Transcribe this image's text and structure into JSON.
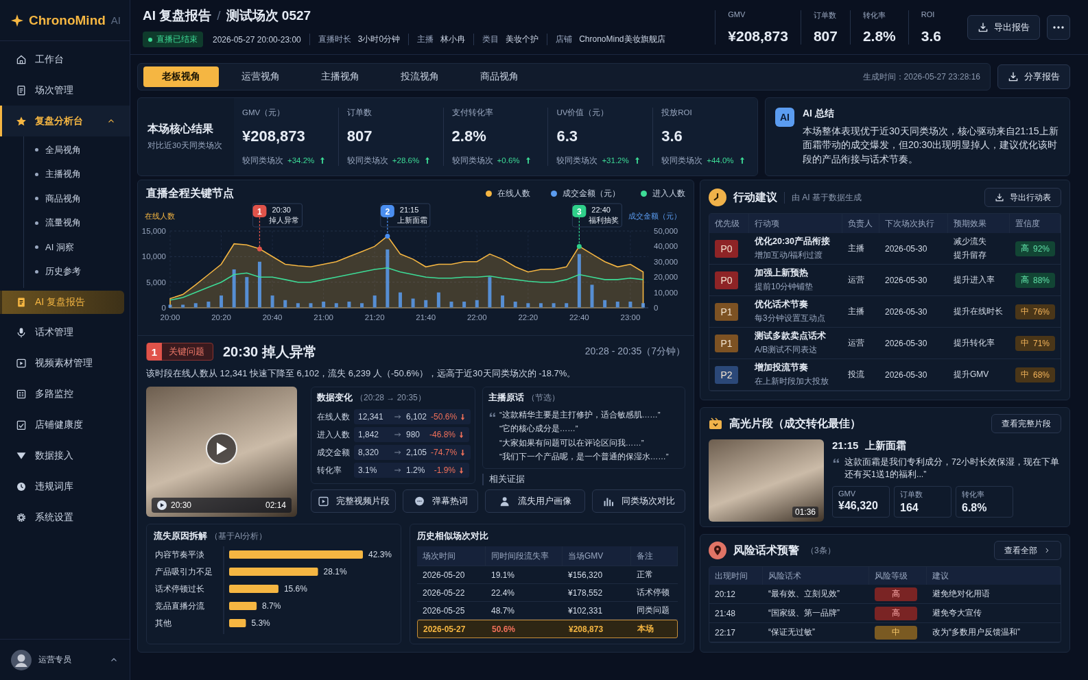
{
  "sidebar": {
    "logo": "ChronoMind",
    "logo_suffix": "AI",
    "items": [
      {
        "label": "工作台",
        "selected": false
      },
      {
        "label": "场次管理",
        "selected": false
      },
      {
        "label": "复盘分析台",
        "selected": false,
        "expanded": true,
        "children": [
          {
            "label": "全局视角",
            "selected": false
          },
          {
            "label": "主播视角",
            "selected": false
          },
          {
            "label": "商品视角",
            "selected": false
          },
          {
            "label": "流量视角",
            "selected": false
          },
          {
            "label": "AI 洞察",
            "selected": false
          },
          {
            "label": "历史参考",
            "selected": false
          }
        ]
      },
      {
        "label": "AI 复盘报告",
        "selected": true
      },
      {
        "label": "话术管理",
        "selected": false
      },
      {
        "label": "视频素材管理",
        "selected": false
      },
      {
        "label": "多路监控",
        "selected": false
      },
      {
        "label": "店铺健康度",
        "selected": false
      },
      {
        "label": "数据接入",
        "selected": false
      },
      {
        "label": "违规词库",
        "selected": false
      },
      {
        "label": "系统设置",
        "selected": false
      }
    ],
    "user": {
      "name": "运营专员"
    }
  },
  "header": {
    "title": "AI 复盘报告",
    "separator": "/",
    "subtitle": "测试场次 0527",
    "status": "直播已结束",
    "meta": [
      {
        "value": "2026-05-27 20:00-23:00"
      },
      {
        "label": "直播时长",
        "value": "3小时0分钟"
      },
      {
        "label": "主播",
        "value": "林小冉"
      },
      {
        "label": "类目",
        "value": "美妆个护"
      },
      {
        "label": "店铺",
        "value": "ChronoMind美妆旗舰店"
      }
    ],
    "stats": [
      {
        "label": "GMV",
        "value": "¥208,873"
      },
      {
        "label": "订单数",
        "value": "807"
      },
      {
        "label": "转化率",
        "value": "2.8%"
      },
      {
        "label": "ROI",
        "value": "3.6"
      }
    ],
    "export_button": "导出报告"
  },
  "tabs": [
    {
      "label": "老板视角",
      "selected": true
    },
    {
      "label": "运营视角",
      "selected": false
    },
    {
      "label": "主播视角",
      "selected": false
    },
    {
      "label": "投流视角",
      "selected": false
    },
    {
      "label": "商品视角",
      "selected": false
    }
  ],
  "generated_at": "生成时间：2026-05-27 23:28:16",
  "share_button": "分享报告",
  "core_results": {
    "title": "本场核心结果",
    "subtitle": "对比近30天同类场次",
    "metrics": [
      {
        "label": "GMV（元）",
        "value": "¥208,873",
        "compare_label": "较同类场次",
        "change": "+34.2%",
        "kind": "up"
      },
      {
        "label": "订单数",
        "value": "807",
        "compare_label": "较同类场次",
        "change": "+28.6%",
        "kind": "up"
      },
      {
        "label": "支付转化率",
        "value": "2.8%",
        "compare_label": "较同类场次",
        "change": "+0.6%",
        "kind": "up"
      },
      {
        "label": "UV价值（元）",
        "value": "6.3",
        "compare_label": "较同类场次",
        "change": "+31.2%",
        "kind": "up"
      },
      {
        "label": "投放ROI",
        "value": "3.6",
        "compare_label": "较同类场次",
        "change": "+44.0%",
        "kind": "up"
      }
    ]
  },
  "ai_summary": {
    "badge": "AI",
    "title": "AI 总结",
    "text": "本场整体表现优于近30天同类场次，核心驱动来自21:15上新面霜带动的成交爆发，但20:30出现明显掉人，建议优化该时段的产品衔接与话术节奏。"
  },
  "key_nodes": {
    "title": "直播全程关键节点",
    "markers": [
      {
        "number": "1",
        "time": "20:30",
        "color": "#e0534a"
      },
      {
        "number": "2",
        "time": "21:15",
        "color": "#4a8ef0"
      },
      {
        "number": "3",
        "time": "22:40",
        "color": "#2fcf8a"
      }
    ],
    "chart_data": {
      "type": "line",
      "ylabel": "在线人数",
      "y2label": "成交金额（元）",
      "categories": [
        "20:00",
        null,
        null,
        null,
        "20:20",
        null,
        null,
        null,
        "20:40",
        null,
        null,
        null,
        "21:00",
        null,
        null,
        null,
        "21:20",
        null,
        null,
        null,
        "21:40",
        null,
        null,
        null,
        "22:00",
        null,
        null,
        null,
        "22:20",
        null,
        null,
        null,
        "22:40",
        null,
        null,
        null,
        "23:00",
        null
      ],
      "ylim": [
        0,
        15000
      ],
      "y2lim": [
        0,
        50000
      ],
      "grid": true,
      "yticks": [
        {
          "value": 0,
          "label": "0"
        },
        {
          "value": 5000,
          "label": "5,000"
        },
        {
          "value": 10000,
          "label": "10,000"
        },
        {
          "value": 15000,
          "label": "15,000"
        }
      ],
      "y2ticks": [
        {
          "value": 0,
          "label": "0"
        },
        {
          "value": 10000,
          "label": "10,000"
        },
        {
          "value": 20000,
          "label": "20,000"
        },
        {
          "value": 30000,
          "label": "30,000"
        },
        {
          "value": 40000,
          "label": "40,000"
        },
        {
          "value": 50000,
          "label": "50,000"
        }
      ],
      "series": [
        {
          "name": "在线人数",
          "color": "#f5b642",
          "type": "area",
          "values": [
            1800,
            2600,
            4500,
            6500,
            8500,
            12500,
            12300,
            11500,
            10000,
            8500,
            8200,
            8000,
            8500,
            9000,
            10000,
            11000,
            12000,
            14000,
            10500,
            9500,
            8000,
            8500,
            8500,
            9000,
            9000,
            10500,
            9500,
            8000,
            7000,
            7500,
            7500,
            8000,
            12000,
            10500,
            9000,
            8000,
            8500,
            7000
          ]
        },
        {
          "name": "成交金额（元）",
          "color": "#5b9cf0",
          "type": "bar",
          "axis": "y2",
          "values": [
            2000,
            2000,
            3000,
            4000,
            8000,
            25000,
            20000,
            30000,
            8000,
            5000,
            3000,
            3000,
            4000,
            3000,
            4000,
            3000,
            8000,
            38000,
            10000,
            6000,
            5000,
            10000,
            4000,
            4000,
            5000,
            20000,
            8000,
            4000,
            3000,
            3000,
            3000,
            3000,
            35000,
            15000,
            5000,
            4000,
            4000,
            3000
          ]
        },
        {
          "name": "进入人数",
          "color": "#3ddc97",
          "type": "line",
          "values": [
            1500,
            2000,
            3000,
            4000,
            5000,
            6500,
            6800,
            6000,
            6000,
            5500,
            5000,
            5000,
            5500,
            6000,
            6500,
            7000,
            7500,
            7800,
            7000,
            6500,
            6000,
            5800,
            5800,
            6000,
            6000,
            6200,
            5800,
            5500,
            5200,
            5000,
            5000,
            5500,
            6500,
            6000,
            5500,
            5500,
            5800,
            5500
          ]
        }
      ],
      "annotations": [
        "掉人异常",
        "上新面霜",
        "福利抽奖"
      ]
    }
  },
  "key_issue": {
    "number": "1",
    "tag": "关键问题",
    "title": "20:30 掉人异常",
    "range": "20:28 - 20:35（7分钟）",
    "description": "该时段在线人数从 12,341 快速下降至 6,102，流失 6,239 人（-50.6%），远高于近30天同类场次的 -18.7%。",
    "video": {
      "start": "20:30",
      "duration": "02:14"
    },
    "data_change": {
      "title": "数据变化",
      "range": "（20:28 → 20:35）",
      "rows": [
        {
          "label": "在线人数",
          "from": "12,341",
          "to": "6,102",
          "change": "-50.6%",
          "kind": "down"
        },
        {
          "label": "进入人数",
          "from": "1,842",
          "to": "980",
          "change": "-46.8%",
          "kind": "down"
        },
        {
          "label": "成交金额",
          "from": "8,320",
          "to": "2,105",
          "change": "-74.7%",
          "kind": "down"
        },
        {
          "label": "转化率",
          "from": "3.1%",
          "to": "1.2%",
          "change": "-1.9%",
          "kind": "down"
        }
      ]
    },
    "quotes": {
      "title": "主播原话",
      "note": "（节选）",
      "lines": [
        "“这款精华主要是主打修护，适合敏感肌……”",
        "“它的核心成分是……”",
        "“大家如果有问题可以在评论区问我……”",
        "“我们下一个产品呢，是一个普通的保湿水……”"
      ]
    },
    "evidence": {
      "title": "相关证据",
      "buttons": [
        "完整视频片段",
        "弹幕热词",
        "流失用户画像",
        "同类场次对比"
      ]
    },
    "loss_reasons": {
      "title": "流失原因拆解",
      "note": "（基于AI分析）",
      "chart_data": {
        "type": "bar",
        "orientation": "horizontal",
        "categories": [
          "内容节奏平淡",
          "产品吸引力不足",
          "话术停顿过长",
          "竞品直播分流",
          "其他"
        ],
        "values": [
          42.3,
          28.1,
          15.6,
          8.7,
          5.3
        ],
        "value_labels": [
          "42.3%",
          "28.1%",
          "15.6%",
          "8.7%",
          "5.3%"
        ]
      }
    },
    "history": {
      "title": "历史相似场次对比",
      "columns": [
        "场次时间",
        "同时间段流失率",
        "当场GMV",
        "备注"
      ],
      "rows": [
        {
          "cells": [
            "2026-05-20",
            "19.1%",
            "¥156,320",
            "正常"
          ],
          "highlighted": false
        },
        {
          "cells": [
            "2026-05-22",
            "22.4%",
            "¥178,552",
            "话术停顿"
          ],
          "highlighted": false
        },
        {
          "cells": [
            "2026-05-25",
            "48.7%",
            "¥102,331",
            "同类问题"
          ],
          "highlighted": false
        },
        {
          "cells": [
            "2026-05-27",
            "50.6%",
            "¥208,873",
            "本场"
          ],
          "highlighted": true
        }
      ]
    }
  },
  "actions": {
    "title": "行动建议",
    "subtitle": "由 AI 基于数据生成",
    "export_button": "导出行动表",
    "columns": [
      "优先级",
      "行动项",
      "负责人",
      "下次场次执行",
      "预期效果",
      "置信度"
    ],
    "rows": [
      {
        "priority": "P0",
        "color": "#8e2426",
        "title": "优化20:30产品衔接",
        "detail": "增加互动/福利过渡",
        "owner": "主播",
        "date": "2026-05-30",
        "effect": [
          "减少流失",
          "提升留存"
        ],
        "kind": "high",
        "confidence_label": "高",
        "confidence": "92%"
      },
      {
        "priority": "P0",
        "color": "#8e2426",
        "title": "加强上新预热",
        "detail": "提前10分钟铺垫",
        "owner": "运营",
        "date": "2026-05-30",
        "effect": [
          "提升进入率"
        ],
        "kind": "high",
        "confidence_label": "高",
        "confidence": "88%"
      },
      {
        "priority": "P1",
        "color": "#7d5223",
        "title": "优化话术节奏",
        "detail": "每3分钟设置互动点",
        "owner": "主播",
        "date": "2026-05-30",
        "effect": [
          "提升在线时长"
        ],
        "kind": "medium",
        "confidence_label": "中",
        "confidence": "76%"
      },
      {
        "priority": "P1",
        "color": "#7d5223",
        "title": "测试多款卖点话术",
        "detail": "A/B测试不同表达",
        "owner": "运营",
        "date": "2026-05-30",
        "effect": [
          "提升转化率"
        ],
        "kind": "medium",
        "confidence_label": "中",
        "confidence": "71%"
      },
      {
        "priority": "P2",
        "color": "#2b4878",
        "title": "增加投流节奏",
        "detail": "在上新时段加大投放",
        "owner": "投流",
        "date": "2026-05-30",
        "effect": [
          "提升GMV"
        ],
        "kind": "medium",
        "confidence_label": "中",
        "confidence": "68%"
      }
    ]
  },
  "highlight": {
    "title": "高光片段（成交转化最佳）",
    "button": "查看完整片段",
    "clip_duration": "01:36",
    "time": "21:15",
    "label": "上新面霜",
    "quote": "这款面霜是我们专利成分，72小时长效保湿，现在下单还有买1送1的福利...”",
    "stats": [
      {
        "label": "GMV",
        "value": "¥46,320"
      },
      {
        "label": "订单数",
        "value": "164"
      },
      {
        "label": "转化率",
        "value": "6.8%"
      }
    ]
  },
  "risks": {
    "title": "风险话术预警",
    "count": "（3条）",
    "button": "查看全部",
    "columns": [
      "出现时间",
      "风险话术",
      "风险等级",
      "建议"
    ],
    "rows": [
      {
        "time": "20:12",
        "phrase": "“最有效、立刻见效”",
        "kind": "high",
        "level_label": "高",
        "advice": "避免绝对化用语"
      },
      {
        "time": "21:48",
        "phrase": "“国家级、第一品牌”",
        "kind": "high",
        "level_label": "高",
        "advice": "避免夸大宣传"
      },
      {
        "time": "22:17",
        "phrase": "“保证无过敏”",
        "kind": "medium",
        "level_label": "中",
        "advice": "改为“多数用户反馈温和”"
      }
    ]
  }
}
